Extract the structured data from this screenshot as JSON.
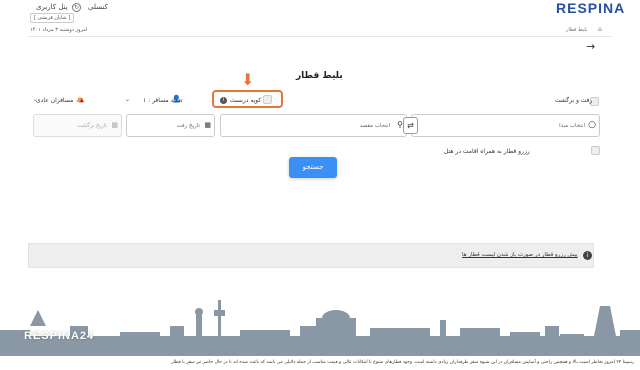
{
  "header": {
    "logo": "RESPINA",
    "user_panel": "پنل کاربری",
    "user_name": "[ شایان قریشی ]",
    "cancel": "کنسلی",
    "today": "امروز دوشنبه ۳ مرداد ۱۴۰۱",
    "breadcrumb_current": "بلیط قطار"
  },
  "page": {
    "title": "بلیط قطار"
  },
  "options": {
    "round_trip": "رفت و برگشت",
    "compartment": "کوپه دربست",
    "passengers": "تعداد مسافر : ۱",
    "class": "مسافران عادی"
  },
  "fields": {
    "origin_placeholder": "انتخاب مبدا",
    "destination_placeholder": "انتخاب مقصد",
    "depart_placeholder": "تاریخ رفت",
    "return_placeholder": "تاریخ برگشت"
  },
  "hotel_option": "رزرو قطار به همراه اقامت در هتل",
  "search_button": "جستجو",
  "info_bar_text": "پیش رزرو قطار در صورت باز شدن لیست قطار ها",
  "footer": {
    "brand": "RESPINA24",
    "description": "رسپینا ۲۴ امروز بخاطر امنیت بالا و همچنین راحتی و آسایش مسافران در این شیوه سفر طرفداران زیادی داشته است. وجود قطارهای متنوع با امکانات عالی و قیمت مناسب از جمله دلایلی می باشد که باعث شده اند تا در حال حاضر تیر سفر با قطار"
  },
  "colors": {
    "accent": "#3b8ff5",
    "logo": "#2a4ea0",
    "highlight": "#e8763a",
    "skyline": "#8a97a4"
  }
}
